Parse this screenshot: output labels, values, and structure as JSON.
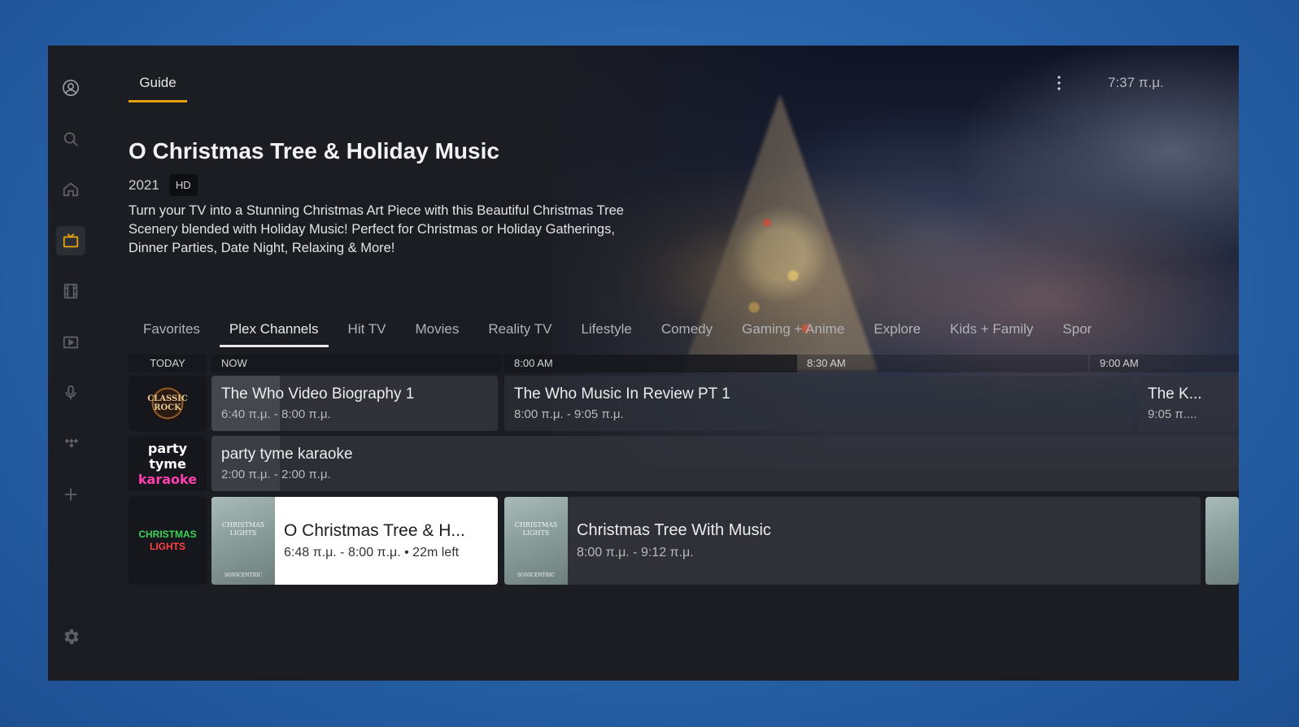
{
  "header": {
    "active_tab": "Guide",
    "clock": "7:37 π.μ."
  },
  "sidebar": {
    "items": [
      {
        "name": "profile",
        "icon": "user-circle-icon"
      },
      {
        "name": "search",
        "icon": "search-icon"
      },
      {
        "name": "home",
        "icon": "home-icon"
      },
      {
        "name": "live-tv",
        "icon": "tv-icon",
        "active": true
      },
      {
        "name": "movies",
        "icon": "film-icon"
      },
      {
        "name": "shows",
        "icon": "play-icon"
      },
      {
        "name": "podcasts",
        "icon": "microphone-icon"
      },
      {
        "name": "music",
        "icon": "tidal-icon"
      },
      {
        "name": "more",
        "icon": "plus-icon"
      }
    ],
    "settings_icon": "gear-icon"
  },
  "hero": {
    "title": "O Christmas Tree & Holiday Music",
    "year": "2021",
    "badge": "HD",
    "description": "Turn your TV into a Stunning Christmas Art Piece with this Beautiful Christmas Tree Scenery blended with Holiday Music! Perfect for Christmas or Holiday Gatherings, Dinner Parties, Date Night, Relaxing & More!"
  },
  "categories": [
    {
      "label": "Favorites"
    },
    {
      "label": "Plex Channels",
      "active": true
    },
    {
      "label": "Hit TV"
    },
    {
      "label": "Movies"
    },
    {
      "label": "Reality TV"
    },
    {
      "label": "Lifestyle"
    },
    {
      "label": "Comedy"
    },
    {
      "label": "Gaming + Anime"
    },
    {
      "label": "Explore"
    },
    {
      "label": "Kids + Family"
    },
    {
      "label": "Spor"
    }
  ],
  "timeline": {
    "today": "TODAY",
    "slots": [
      "NOW",
      "8:00 AM",
      "8:30 AM",
      "9:00 AM"
    ]
  },
  "channels": [
    {
      "logo": {
        "line1": "CLASSIC",
        "line2": "ROCK"
      },
      "programs": [
        {
          "title": "The Who Video Biography 1",
          "time": "6:40 π.μ. - 8:00 π.μ.",
          "progress": 0.24
        },
        {
          "title": "The Who Music In Review PT 1",
          "time": "8:00 π.μ. - 9:05 π.μ."
        },
        {
          "title": "The K...",
          "time": "9:05 π...."
        }
      ]
    },
    {
      "logo": {
        "line1": "party tyme",
        "line2": "karaoke"
      },
      "programs": [
        {
          "title": "party tyme karaoke",
          "time": "2:00 π.μ. - 2:00 π.μ."
        }
      ]
    },
    {
      "logo": {
        "line1": "CHRISTMAS",
        "line2": "LIGHTS"
      },
      "programs": [
        {
          "title": "O Christmas Tree & H...",
          "time": "6:48 π.μ. - 8:00 π.μ.  •  22m left",
          "selected": true,
          "thumb": {
            "line1": "CHRISTMAS",
            "line2": "LIGHTS",
            "sub": "SONICENTRIC"
          }
        },
        {
          "title": "Christmas Tree With Music",
          "time": "8:00 π.μ. - 9:12 π.μ.",
          "thumb": {
            "line1": "CHRISTMAS",
            "line2": "LIGHTS",
            "sub": "SONICENTRIC"
          }
        }
      ]
    }
  ],
  "colors": {
    "accent": "#e5a00d",
    "panel": "#1c1d23",
    "outer_bg": "#2a66ad"
  }
}
